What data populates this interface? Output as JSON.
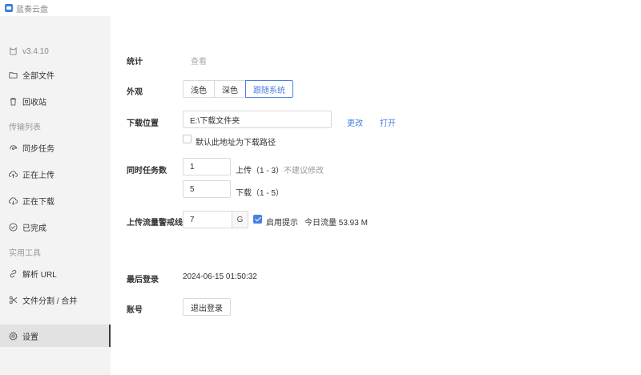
{
  "window": {
    "title": "蓝奏云盘"
  },
  "sidebar": {
    "version": "v3.4.10",
    "items": [
      {
        "label": "全部文件",
        "icon": "folder-icon"
      },
      {
        "label": "回收站",
        "icon": "trash-icon"
      }
    ],
    "transfer_section": "传输列表",
    "transfer_items": [
      {
        "label": "同步任务",
        "icon": "sync-icon"
      },
      {
        "label": "正在上传",
        "icon": "upload-icon"
      },
      {
        "label": "正在下载",
        "icon": "download-icon"
      },
      {
        "label": "已完成",
        "icon": "check-circle-icon"
      }
    ],
    "tools_section": "实用工具",
    "tool_items": [
      {
        "label": "解析 URL",
        "icon": "link-icon"
      },
      {
        "label": "文件分割 / 合并",
        "icon": "scissors-icon"
      }
    ],
    "settings": {
      "label": "设置",
      "icon": "gear-icon"
    }
  },
  "settings": {
    "stats": {
      "label": "统计",
      "action": "查看"
    },
    "appearance": {
      "label": "外观",
      "options": [
        "浅色",
        "深色",
        "跟随系统"
      ],
      "selected": "跟随系统"
    },
    "download_location": {
      "label": "下载位置",
      "path": "E:\\下载文件夹",
      "change": "更改",
      "open": "打开",
      "default_checkbox": "默认此地址为下载路径",
      "default_checked": false
    },
    "concurrency": {
      "label": "同时任务数",
      "upload_value": "1",
      "upload_desc": "上传（1 - 3）",
      "upload_hint": "不建议修改",
      "download_value": "5",
      "download_desc": "下载（1 - 5）"
    },
    "upload_warning": {
      "label": "上传流量警戒线",
      "value": "7",
      "unit": "G",
      "enable_label": "启用提示",
      "enabled": true,
      "today_traffic": "今日流量 53.93 M"
    },
    "last_login": {
      "label": "最后登录",
      "value": "2024-06-15 01:50:32"
    },
    "account": {
      "label": "账号",
      "logout": "退出登录"
    }
  },
  "colors": {
    "accent": "#4a7fe0",
    "sidebar_bg": "#f3f3f3"
  }
}
